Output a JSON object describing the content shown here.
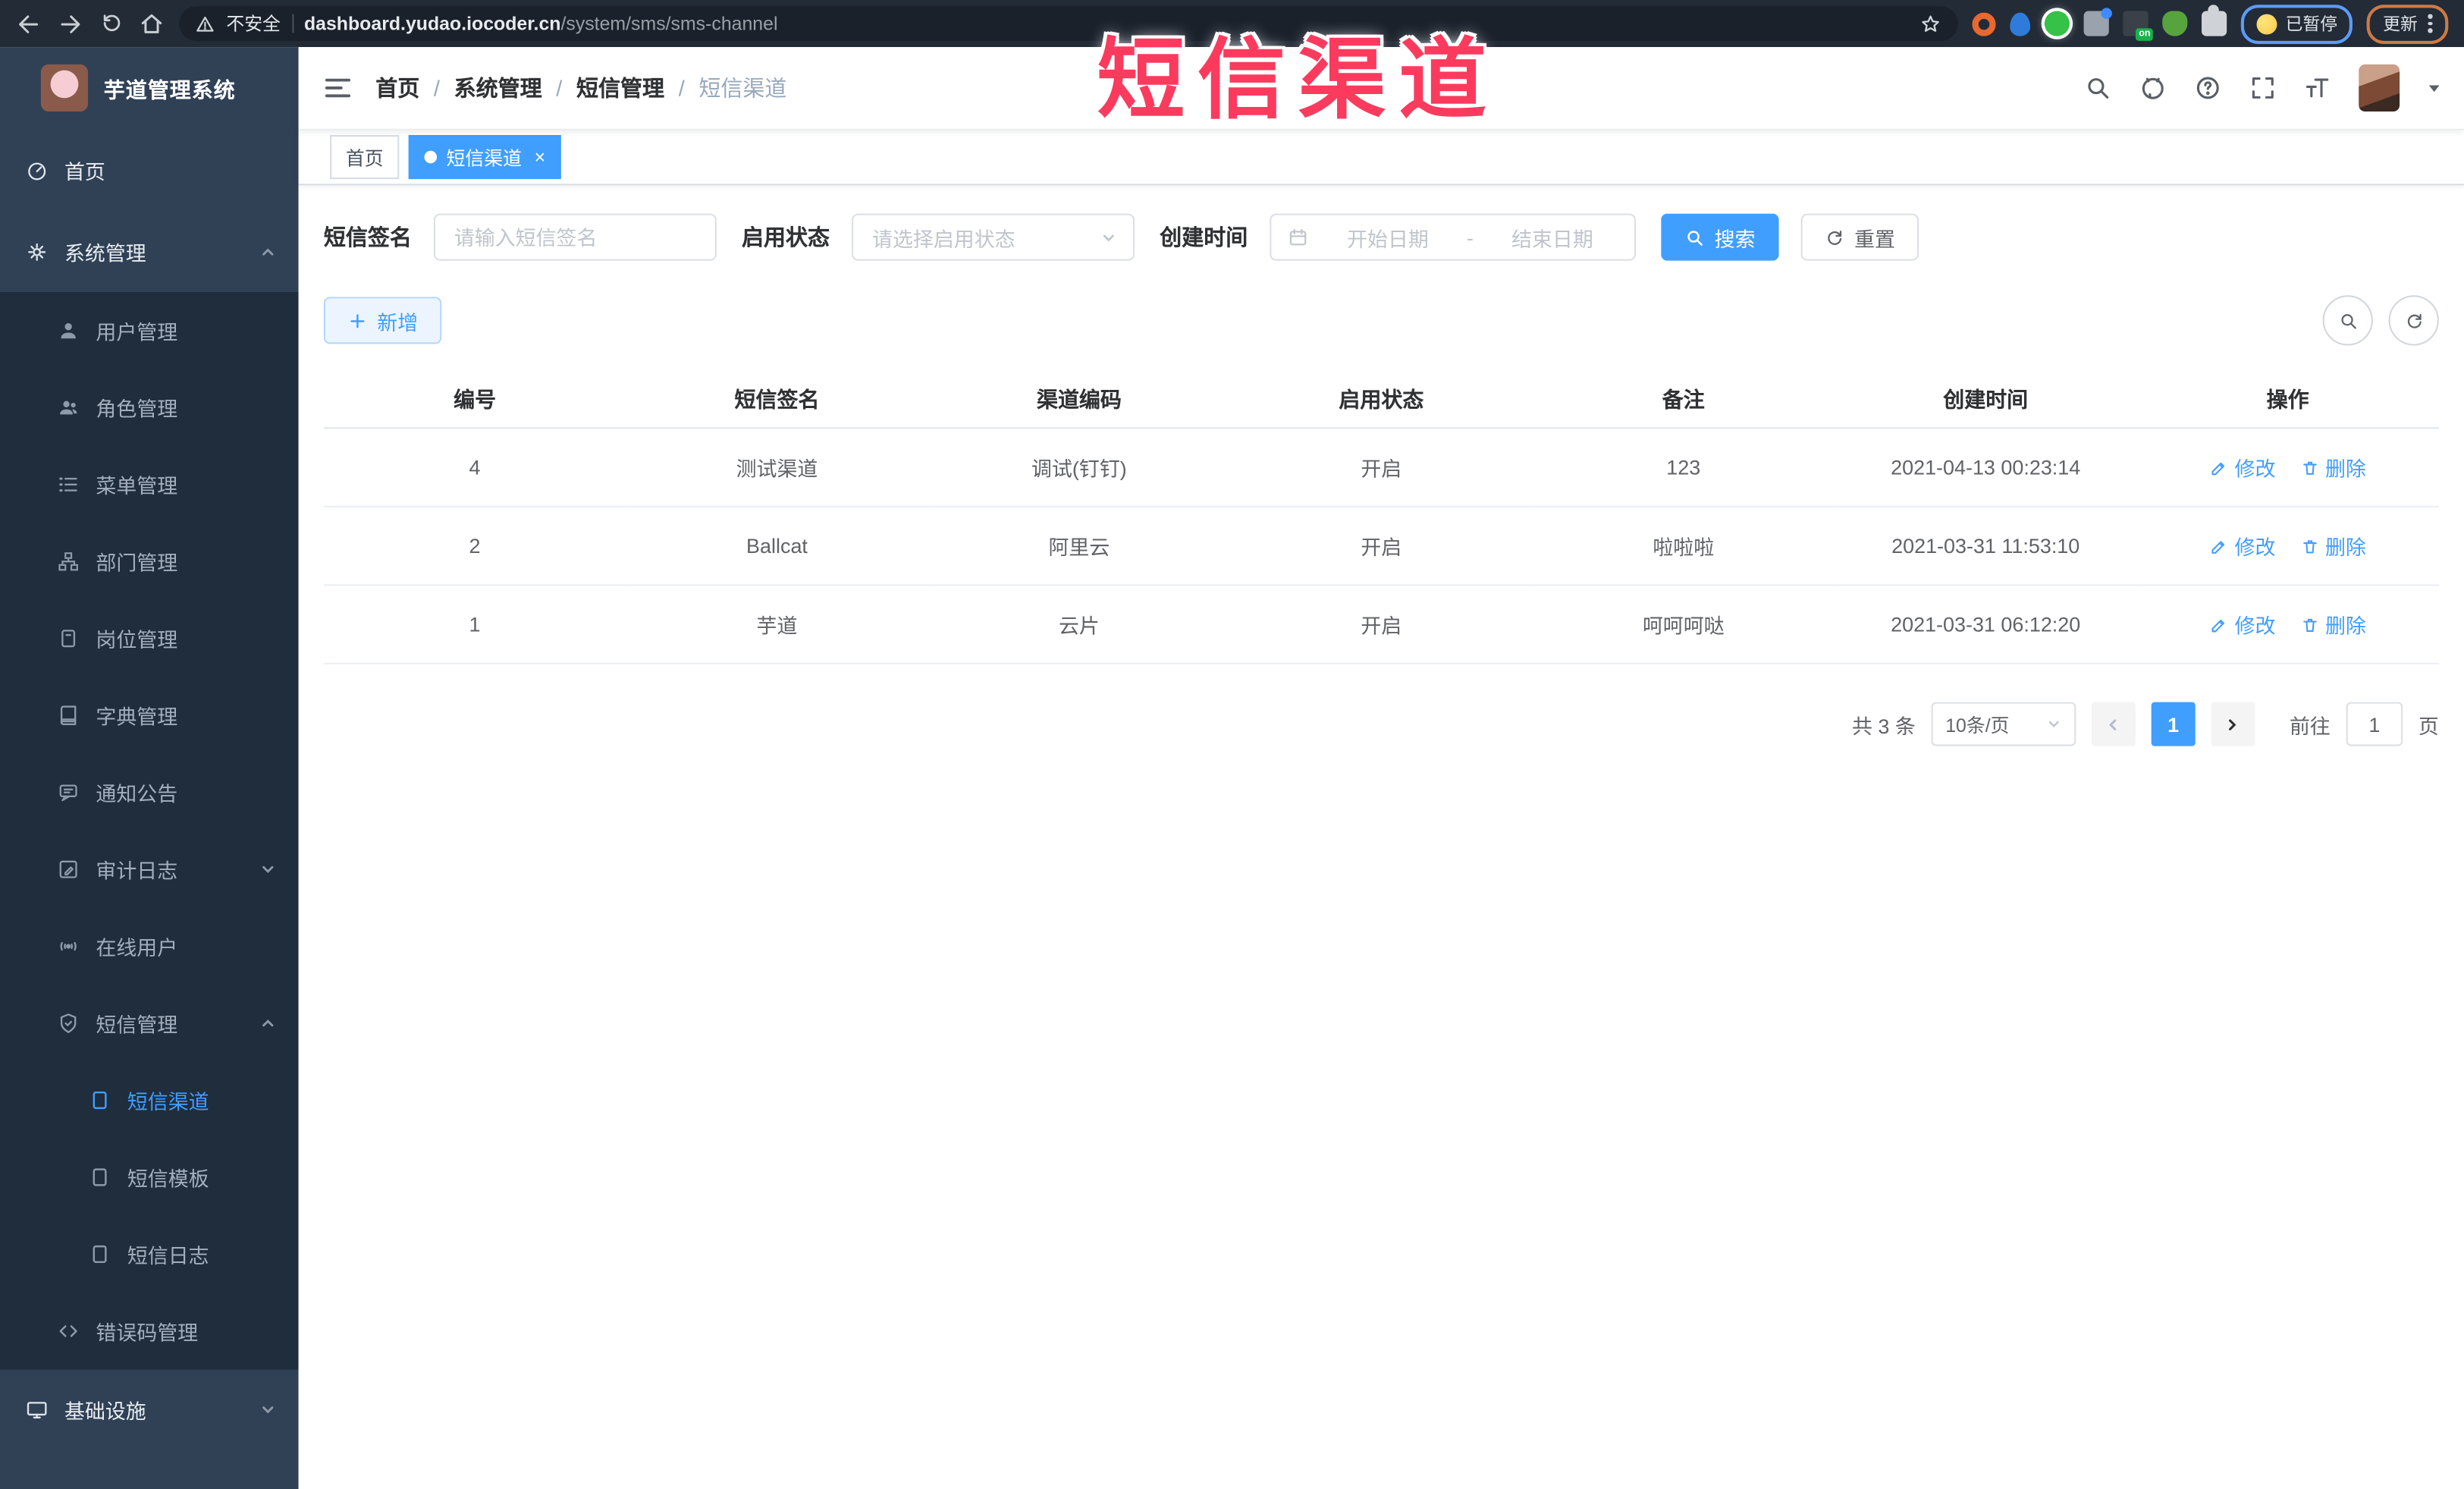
{
  "browser": {
    "security_label": "不安全",
    "url_host": "dashboard.yudao.iocoder.cn",
    "url_path": "/system/sms/sms-channel",
    "on_badge": "on",
    "paused_label": "已暂停",
    "update_label": "更新"
  },
  "overlay": {
    "title": "短信渠道"
  },
  "sidebar": {
    "app_title": "芋道管理系统",
    "items": [
      {
        "label": "首页"
      },
      {
        "label": "系统管理"
      },
      {
        "label": "用户管理"
      },
      {
        "label": "角色管理"
      },
      {
        "label": "菜单管理"
      },
      {
        "label": "部门管理"
      },
      {
        "label": "岗位管理"
      },
      {
        "label": "字典管理"
      },
      {
        "label": "通知公告"
      },
      {
        "label": "审计日志"
      },
      {
        "label": "在线用户"
      },
      {
        "label": "短信管理"
      },
      {
        "label": "短信渠道"
      },
      {
        "label": "短信模板"
      },
      {
        "label": "短信日志"
      },
      {
        "label": "错误码管理"
      },
      {
        "label": "基础设施"
      }
    ]
  },
  "header": {
    "breadcrumb": [
      "首页",
      "系统管理",
      "短信管理",
      "短信渠道"
    ],
    "sep": "/"
  },
  "tabs": {
    "home": "首页",
    "active": "短信渠道",
    "close": "×"
  },
  "filters": {
    "sign_label": "短信签名",
    "sign_placeholder": "请输入短信签名",
    "status_label": "启用状态",
    "status_placeholder": "请选择启用状态",
    "time_label": "创建时间",
    "date_start_placeholder": "开始日期",
    "date_sep": "-",
    "date_end_placeholder": "结束日期",
    "search_label": "搜索",
    "reset_label": "重置"
  },
  "toolbar": {
    "add_label": "新增"
  },
  "table": {
    "columns": [
      "编号",
      "短信签名",
      "渠道编码",
      "启用状态",
      "备注",
      "创建时间",
      "操作"
    ],
    "rows": [
      {
        "id": "4",
        "sign": "测试渠道",
        "code": "调试(钉钉)",
        "status": "开启",
        "remark": "123",
        "created": "2021-04-13 00:23:14"
      },
      {
        "id": "2",
        "sign": "Ballcat",
        "code": "阿里云",
        "status": "开启",
        "remark": "啦啦啦",
        "created": "2021-03-31 11:53:10"
      },
      {
        "id": "1",
        "sign": "芋道",
        "code": "云片",
        "status": "开启",
        "remark": "呵呵呵哒",
        "created": "2021-03-31 06:12:20"
      }
    ],
    "edit_label": "修改",
    "delete_label": "删除"
  },
  "pagination": {
    "total": "共 3 条",
    "size": "10条/页",
    "page": "1",
    "goto_label": "前往",
    "goto_value": "1",
    "unit": "页"
  },
  "colors": {
    "accent": "#409EFF",
    "overlay_red": "#fa3b5e",
    "sidebar_bg": "#304156",
    "submenu_bg": "#1f2d3d",
    "chrome_bg": "#232b37"
  }
}
